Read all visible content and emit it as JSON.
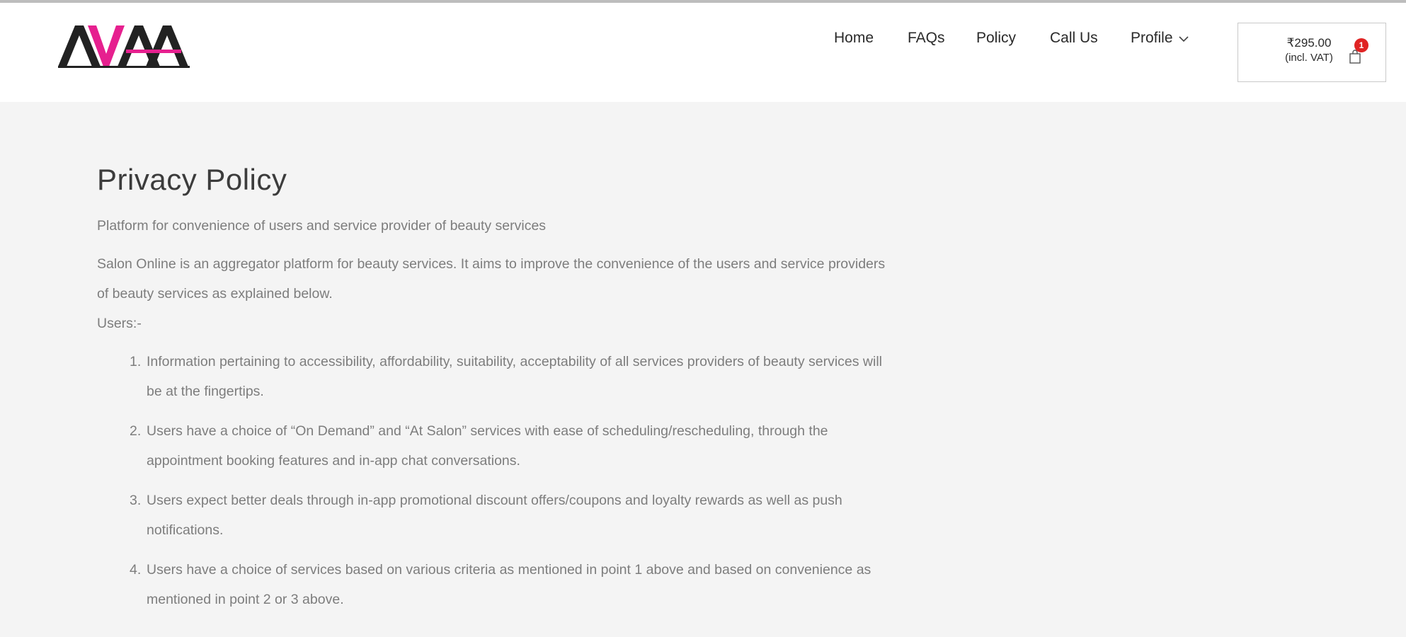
{
  "brand": {
    "logo_text": "AVAA",
    "colors": {
      "dark": "#222222",
      "accent": "#e6208f"
    }
  },
  "nav": {
    "items": [
      {
        "label": "Home"
      },
      {
        "label": "FAQs"
      },
      {
        "label": "Policy"
      },
      {
        "label": "Call Us"
      }
    ],
    "profile": {
      "label": "Profile",
      "icon": "chevron-down-icon"
    }
  },
  "cart": {
    "amount": "₹295.00",
    "vat_label": "(incl. VAT)",
    "count": "1",
    "icon": "shopping-bag-icon",
    "badge_color": "#e02424"
  },
  "page": {
    "title": "Privacy Policy",
    "subtitle": "Platform for convenience of users and service provider of beauty services",
    "intro": "Salon Online is an aggregator platform for beauty services. It aims to improve the convenience of the users and service providers of beauty services as explained below.",
    "users_label": "Users:-",
    "users_points": [
      {
        "num": "1.",
        "text": "Information pertaining to accessibility, affordability, suitability, acceptability of all services providers of beauty services will be at the fingertips."
      },
      {
        "num": "2.",
        "text": "Users have a choice of “On Demand” and “At Salon” services with ease of scheduling/rescheduling, through the appointment booking features and in-app chat conversations."
      },
      {
        "num": "3.",
        "text": "Users expect better deals through in-app promotional discount offers/coupons and loyalty rewards as well as push notifications."
      },
      {
        "num": "4.",
        "text": "Users have a choice of services based on various criteria as mentioned in point 1 above and based on convenience as mentioned in point 2 or 3 above."
      }
    ]
  }
}
